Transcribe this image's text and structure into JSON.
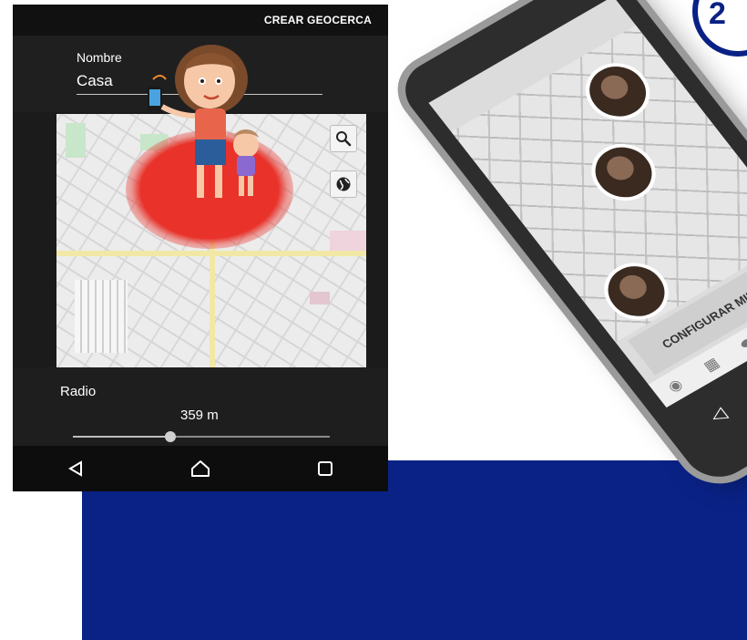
{
  "header": {
    "action_label": "CREAR GEOCERCA"
  },
  "form": {
    "name_label": "Nombre",
    "name_value": "Casa"
  },
  "map": {
    "search_icon": "search-icon",
    "layers_icon": "globe-icon"
  },
  "radius": {
    "label": "Radio",
    "value_text": "359 m",
    "slider_fraction": 0.38
  },
  "nav": {
    "back_icon": "triangle-back-icon",
    "home_icon": "home-icon",
    "recents_icon": "square-recents-icon"
  },
  "back_phone": {
    "config_label": "CONFIGURAR MIEMBRO"
  },
  "badge": {
    "text": "2"
  },
  "colors": {
    "accent_blue": "#0a2286",
    "geofence_red": "#e8322a",
    "dark_bg": "#1b1b1b"
  }
}
